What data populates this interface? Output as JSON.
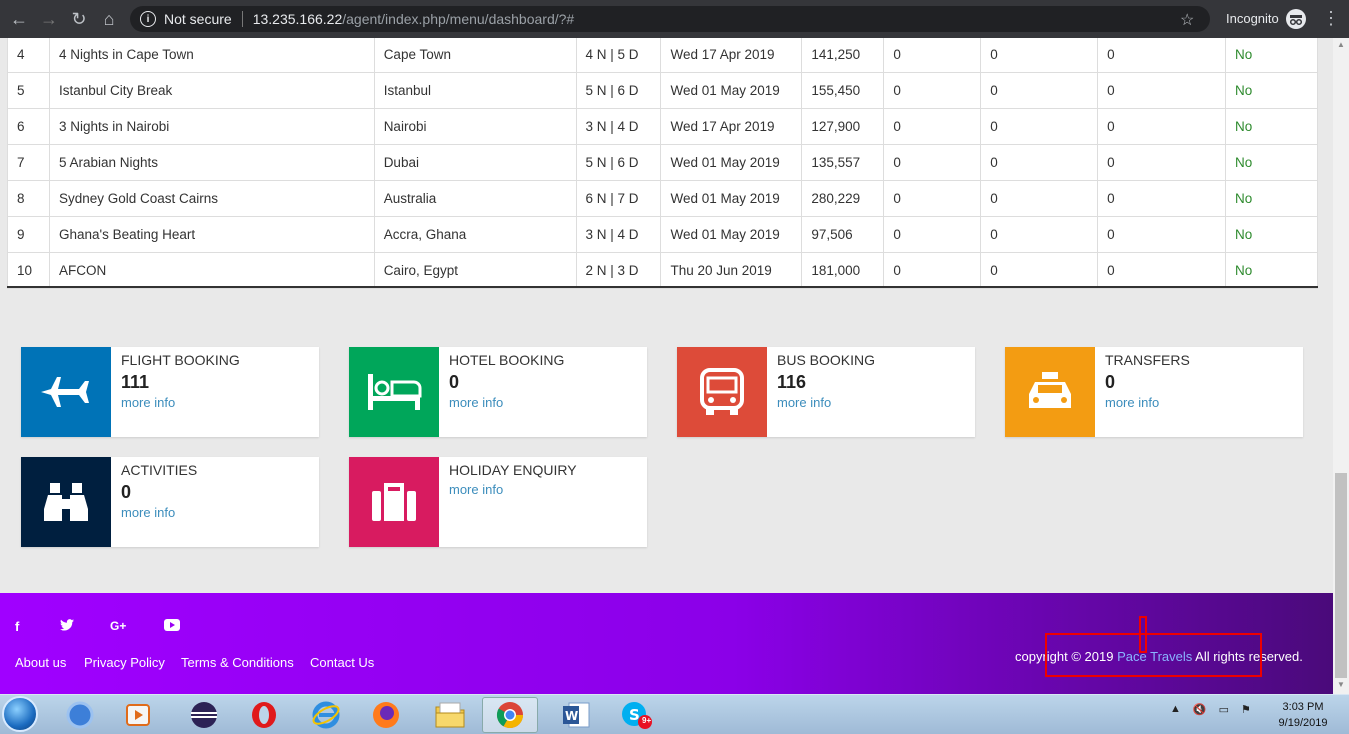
{
  "browser": {
    "security_label": "Not secure",
    "url_host": "13.235.166.22",
    "url_path": "/agent/index.php/menu/dashboard/?#",
    "profile_label": "Incognito"
  },
  "table": {
    "rows": [
      {
        "no": "4",
        "name": "4 Nights in Cape Town",
        "dest": "Cape Town",
        "duration": "4 N | 5 D",
        "date": "Wed 17 Apr 2019",
        "price": "141,250",
        "c1": "0",
        "c2": "0",
        "c3": "0",
        "status": "No"
      },
      {
        "no": "5",
        "name": "Istanbul City Break",
        "dest": "Istanbul",
        "duration": "5 N | 6 D",
        "date": "Wed 01 May 2019",
        "price": "155,450",
        "c1": "0",
        "c2": "0",
        "c3": "0",
        "status": "No"
      },
      {
        "no": "6",
        "name": "3 Nights in Nairobi",
        "dest": "Nairobi",
        "duration": "3 N | 4 D",
        "date": "Wed 17 Apr 2019",
        "price": "127,900",
        "c1": "0",
        "c2": "0",
        "c3": "0",
        "status": "No"
      },
      {
        "no": "7",
        "name": "5 Arabian Nights",
        "dest": "Dubai",
        "duration": "5 N | 6 D",
        "date": "Wed 01 May 2019",
        "price": "135,557",
        "c1": "0",
        "c2": "0",
        "c3": "0",
        "status": "No"
      },
      {
        "no": "8",
        "name": "Sydney Gold Coast Cairns",
        "dest": "Australia",
        "duration": "6 N | 7 D",
        "date": "Wed 01 May 2019",
        "price": "280,229",
        "c1": "0",
        "c2": "0",
        "c3": "0",
        "status": "No"
      },
      {
        "no": "9",
        "name": "Ghana's Beating Heart",
        "dest": "Accra, Ghana",
        "duration": "3 N | 4 D",
        "date": "Wed 01 May 2019",
        "price": "97,506",
        "c1": "0",
        "c2": "0",
        "c3": "0",
        "status": "No"
      },
      {
        "no": "10",
        "name": "AFCON",
        "dest": "Cairo, Egypt",
        "duration": "2 N | 3 D",
        "date": "Thu 20 Jun 2019",
        "price": "181,000",
        "c1": "0",
        "c2": "0",
        "c3": "0",
        "status": "No"
      }
    ]
  },
  "cards": {
    "flight": {
      "title": "FLIGHT BOOKING",
      "count": "111",
      "more": "more info",
      "color": "#0073b7",
      "icon": "airplane-icon"
    },
    "hotel": {
      "title": "HOTEL BOOKING",
      "count": "0",
      "more": "more info",
      "color": "#00a65a",
      "icon": "bed-icon"
    },
    "bus": {
      "title": "BUS BOOKING",
      "count": "116",
      "more": "more info",
      "color": "#dd4b39",
      "icon": "bus-icon"
    },
    "transfers": {
      "title": "TRANSFERS",
      "count": "0",
      "more": "more info",
      "color": "#f39c12",
      "icon": "taxi-icon"
    },
    "activities": {
      "title": "ACTIVITIES",
      "count": "0",
      "more": "more info",
      "color": "#001f3f",
      "icon": "binoculars-icon"
    },
    "holiday": {
      "title": "HOLIDAY ENQUIRY",
      "more": "more info",
      "color": "#d81b60",
      "icon": "suitcase-icon"
    }
  },
  "footer": {
    "social": {
      "facebook": "f",
      "twitter": "t",
      "google": "G+",
      "youtube": "▶"
    },
    "links": [
      "About us",
      "Privacy Policy",
      "Terms & Conditions",
      "Contact Us"
    ],
    "copyright_pre": "copyright © 2019",
    "brand": "Pace Travels",
    "copyright_post": "All rights reserved."
  },
  "taskbar": {
    "time": "3:03 PM",
    "date": "9/19/2019",
    "skype_badge": "9+"
  }
}
